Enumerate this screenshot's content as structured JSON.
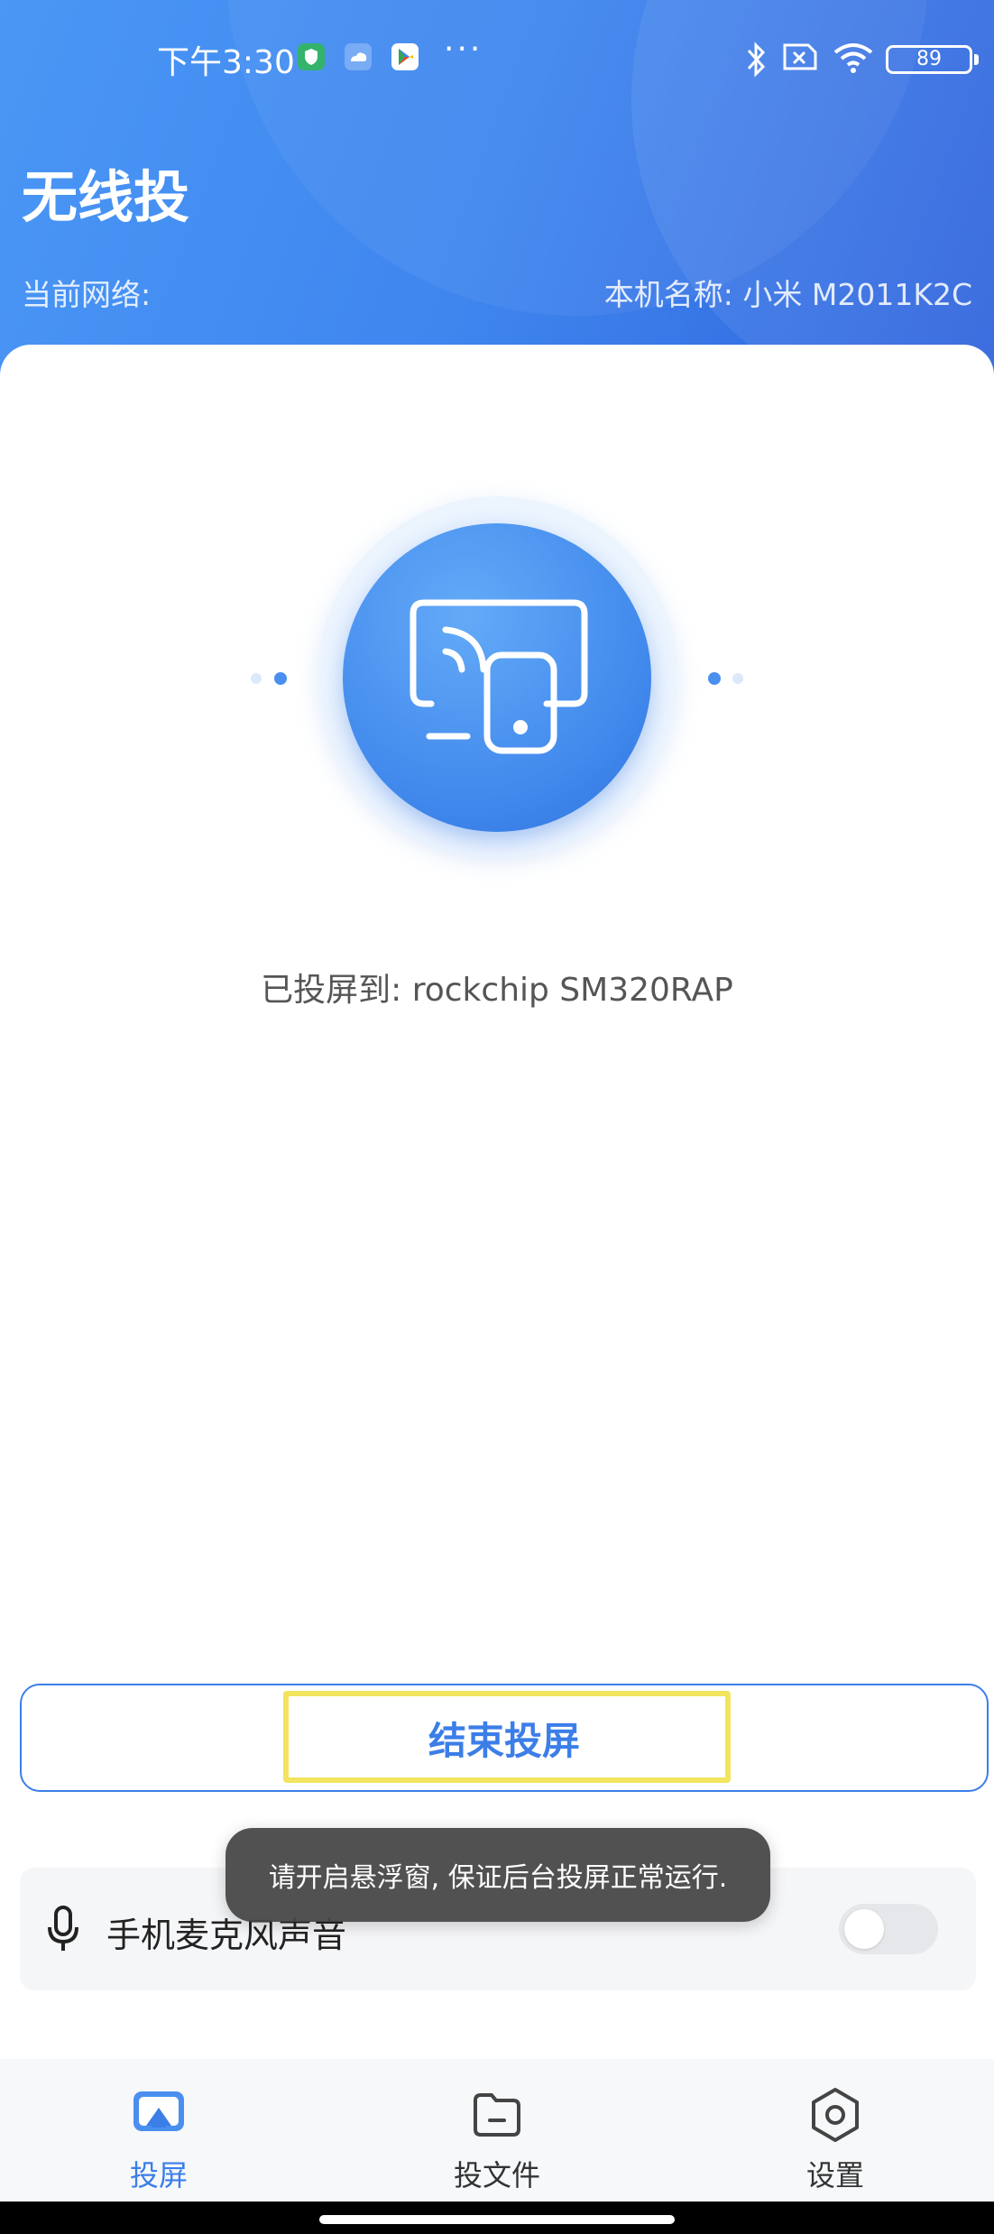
{
  "status_bar": {
    "time": "下午3:30",
    "more_dots": "···",
    "battery": "89",
    "icons": [
      "app-shield-icon",
      "app-cloud-icon",
      "play-store-icon",
      "bluetooth-icon",
      "no-sim-icon",
      "wifi-icon",
      "battery-icon"
    ]
  },
  "header": {
    "title": "无线投",
    "network_label": "当前网络:",
    "device_name": "本机名称: 小米 M2011K2C"
  },
  "cast": {
    "icon": "screen-cast-icon",
    "status_text": "已投屏到: rockchip SM320RAP"
  },
  "end_button": {
    "label": "结束投屏",
    "highlighted": true
  },
  "mic_row": {
    "icon": "microphone-icon",
    "label": "手机麦克风声音",
    "toggle_on": false
  },
  "toast": {
    "text": "请开启悬浮窗, 保证后台投屏正常运行."
  },
  "bottom_nav": {
    "items": [
      {
        "label": "投屏",
        "icon": "screen-cast-tab-icon",
        "active": true
      },
      {
        "label": "投文件",
        "icon": "folder-icon",
        "active": false
      },
      {
        "label": "设置",
        "icon": "settings-icon",
        "active": false
      }
    ]
  },
  "colors": {
    "accent": "#3b7ee8",
    "header_start": "#4a97f5",
    "header_end": "#2f63dc",
    "highlight": "#f2e45e",
    "toast_bg": "#464646"
  }
}
